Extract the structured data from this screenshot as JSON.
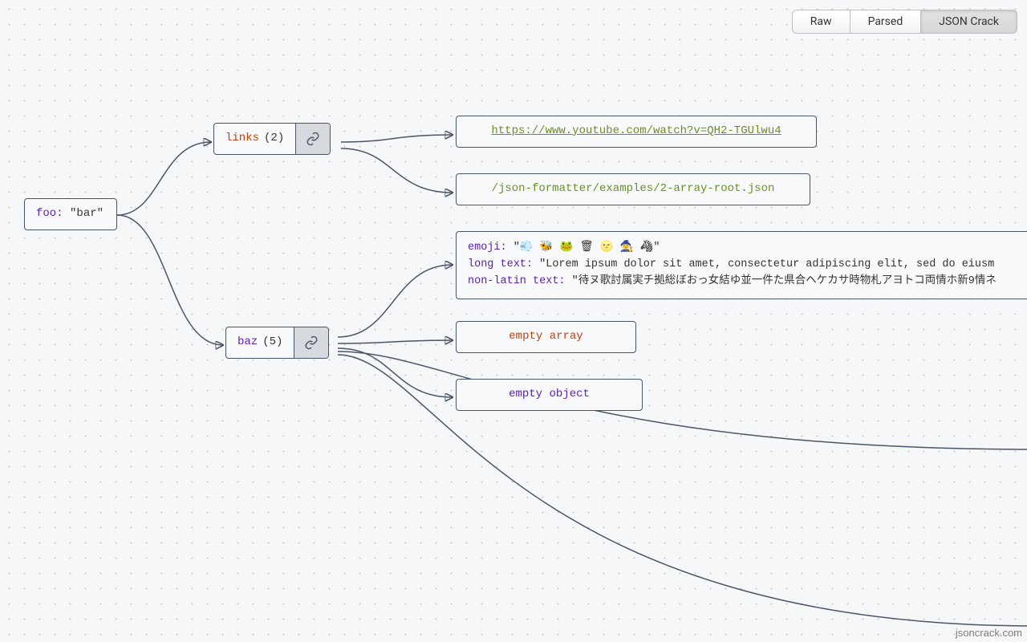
{
  "tabs": {
    "raw": "Raw",
    "parsed": "Parsed",
    "jsoncrack": "JSON Crack",
    "active": "jsoncrack"
  },
  "brand": "jsoncrack.com",
  "nodes": {
    "root": {
      "key": "foo:",
      "value": "\"bar\""
    },
    "links": {
      "label": "links",
      "count": "(2)"
    },
    "baz": {
      "label": "baz",
      "count": "(5)"
    },
    "url1": "https://www.youtube.com/watch?v=QH2-TGUlwu4",
    "url2": "/json-formatter/examples/2-array-root.json",
    "textblock": {
      "emoji_k": "emoji:",
      "emoji_v": "\"💨 🐝 🐸 🗑 🌝 🧙 🦓\"",
      "long_k": "long text:",
      "long_v": "\"Lorem ipsum dolor sit amet, consectetur adipiscing elit, sed do eiusm",
      "nonlatin_k": "non-latin text:",
      "nonlatin_v": "\"待ヌ歌討属実チ拠総ぼおっ女結ゆ並一件た県合ヘケカサ時物札アヨトコ両情ホ新9情ネ"
    },
    "empty_array": "empty array",
    "empty_object": "empty object"
  }
}
